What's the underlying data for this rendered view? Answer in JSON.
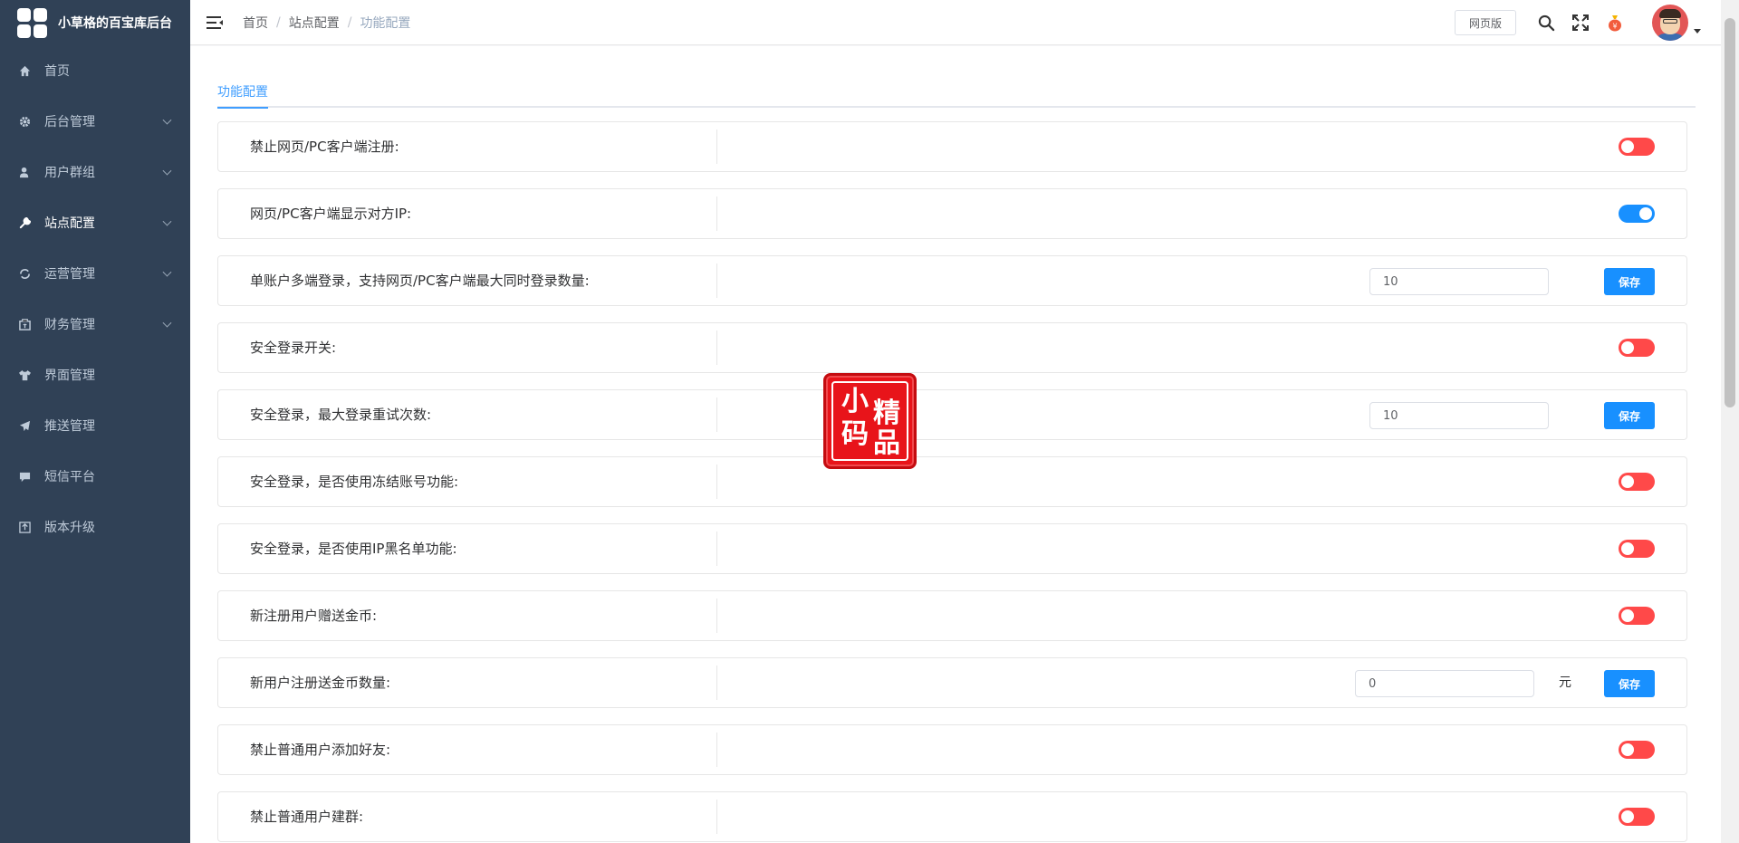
{
  "app": {
    "title": "小草格的百宝库后台"
  },
  "sidebar": {
    "items": [
      {
        "label": "首页",
        "icon": "home-icon",
        "has_arrow": false
      },
      {
        "label": "后台管理",
        "icon": "gear-icon",
        "has_arrow": true
      },
      {
        "label": "用户群组",
        "icon": "user-icon",
        "has_arrow": true
      },
      {
        "label": "站点配置",
        "icon": "wrench-icon",
        "has_arrow": true,
        "active": true
      },
      {
        "label": "运营管理",
        "icon": "operation-icon",
        "has_arrow": true
      },
      {
        "label": "财务管理",
        "icon": "finance-icon",
        "has_arrow": true
      },
      {
        "label": "界面管理",
        "icon": "shirt-icon",
        "has_arrow": false
      },
      {
        "label": "推送管理",
        "icon": "send-icon",
        "has_arrow": false
      },
      {
        "label": "短信平台",
        "icon": "message-icon",
        "has_arrow": false
      },
      {
        "label": "版本升级",
        "icon": "upgrade-icon",
        "has_arrow": false
      }
    ]
  },
  "header": {
    "breadcrumb": [
      "首页",
      "站点配置",
      "功能配置"
    ],
    "web_version_label": "网页版"
  },
  "main": {
    "tab_label": "功能配置",
    "rows": [
      {
        "label": "禁止网页/PC客户端注册:",
        "type": "switch",
        "on": false
      },
      {
        "label": "网页/PC客户端显示对方IP:",
        "type": "switch",
        "on": true
      },
      {
        "label": "单账户多端登录，支持网页/PC客户端最大同时登录数量:",
        "type": "input",
        "value": "10",
        "button": "保存"
      },
      {
        "label": "安全登录开关:",
        "type": "switch",
        "on": false
      },
      {
        "label": "安全登录，最大登录重试次数:",
        "type": "input",
        "value": "10",
        "button": "保存"
      },
      {
        "label": "安全登录，是否使用冻结账号功能:",
        "type": "switch",
        "on": false
      },
      {
        "label": "安全登录，是否使用IP黑名单功能:",
        "type": "switch",
        "on": false
      },
      {
        "label": "新注册用户赠送金币:",
        "type": "switch",
        "on": false
      },
      {
        "label": "新用户注册送金币数量:",
        "type": "input_unit",
        "value": "0",
        "unit": "元",
        "button": "保存"
      },
      {
        "label": "禁止普通用户添加好友:",
        "type": "switch",
        "on": false
      },
      {
        "label": "禁止普通用户建群:",
        "type": "switch",
        "on": false
      }
    ]
  },
  "stamp": {
    "chars": [
      "小",
      "精",
      "码",
      "品"
    ]
  },
  "colors": {
    "sidebar_bg": "#304156",
    "primary": "#1890ff",
    "switch_off": "#ff4949",
    "stamp": "#e8141a"
  }
}
